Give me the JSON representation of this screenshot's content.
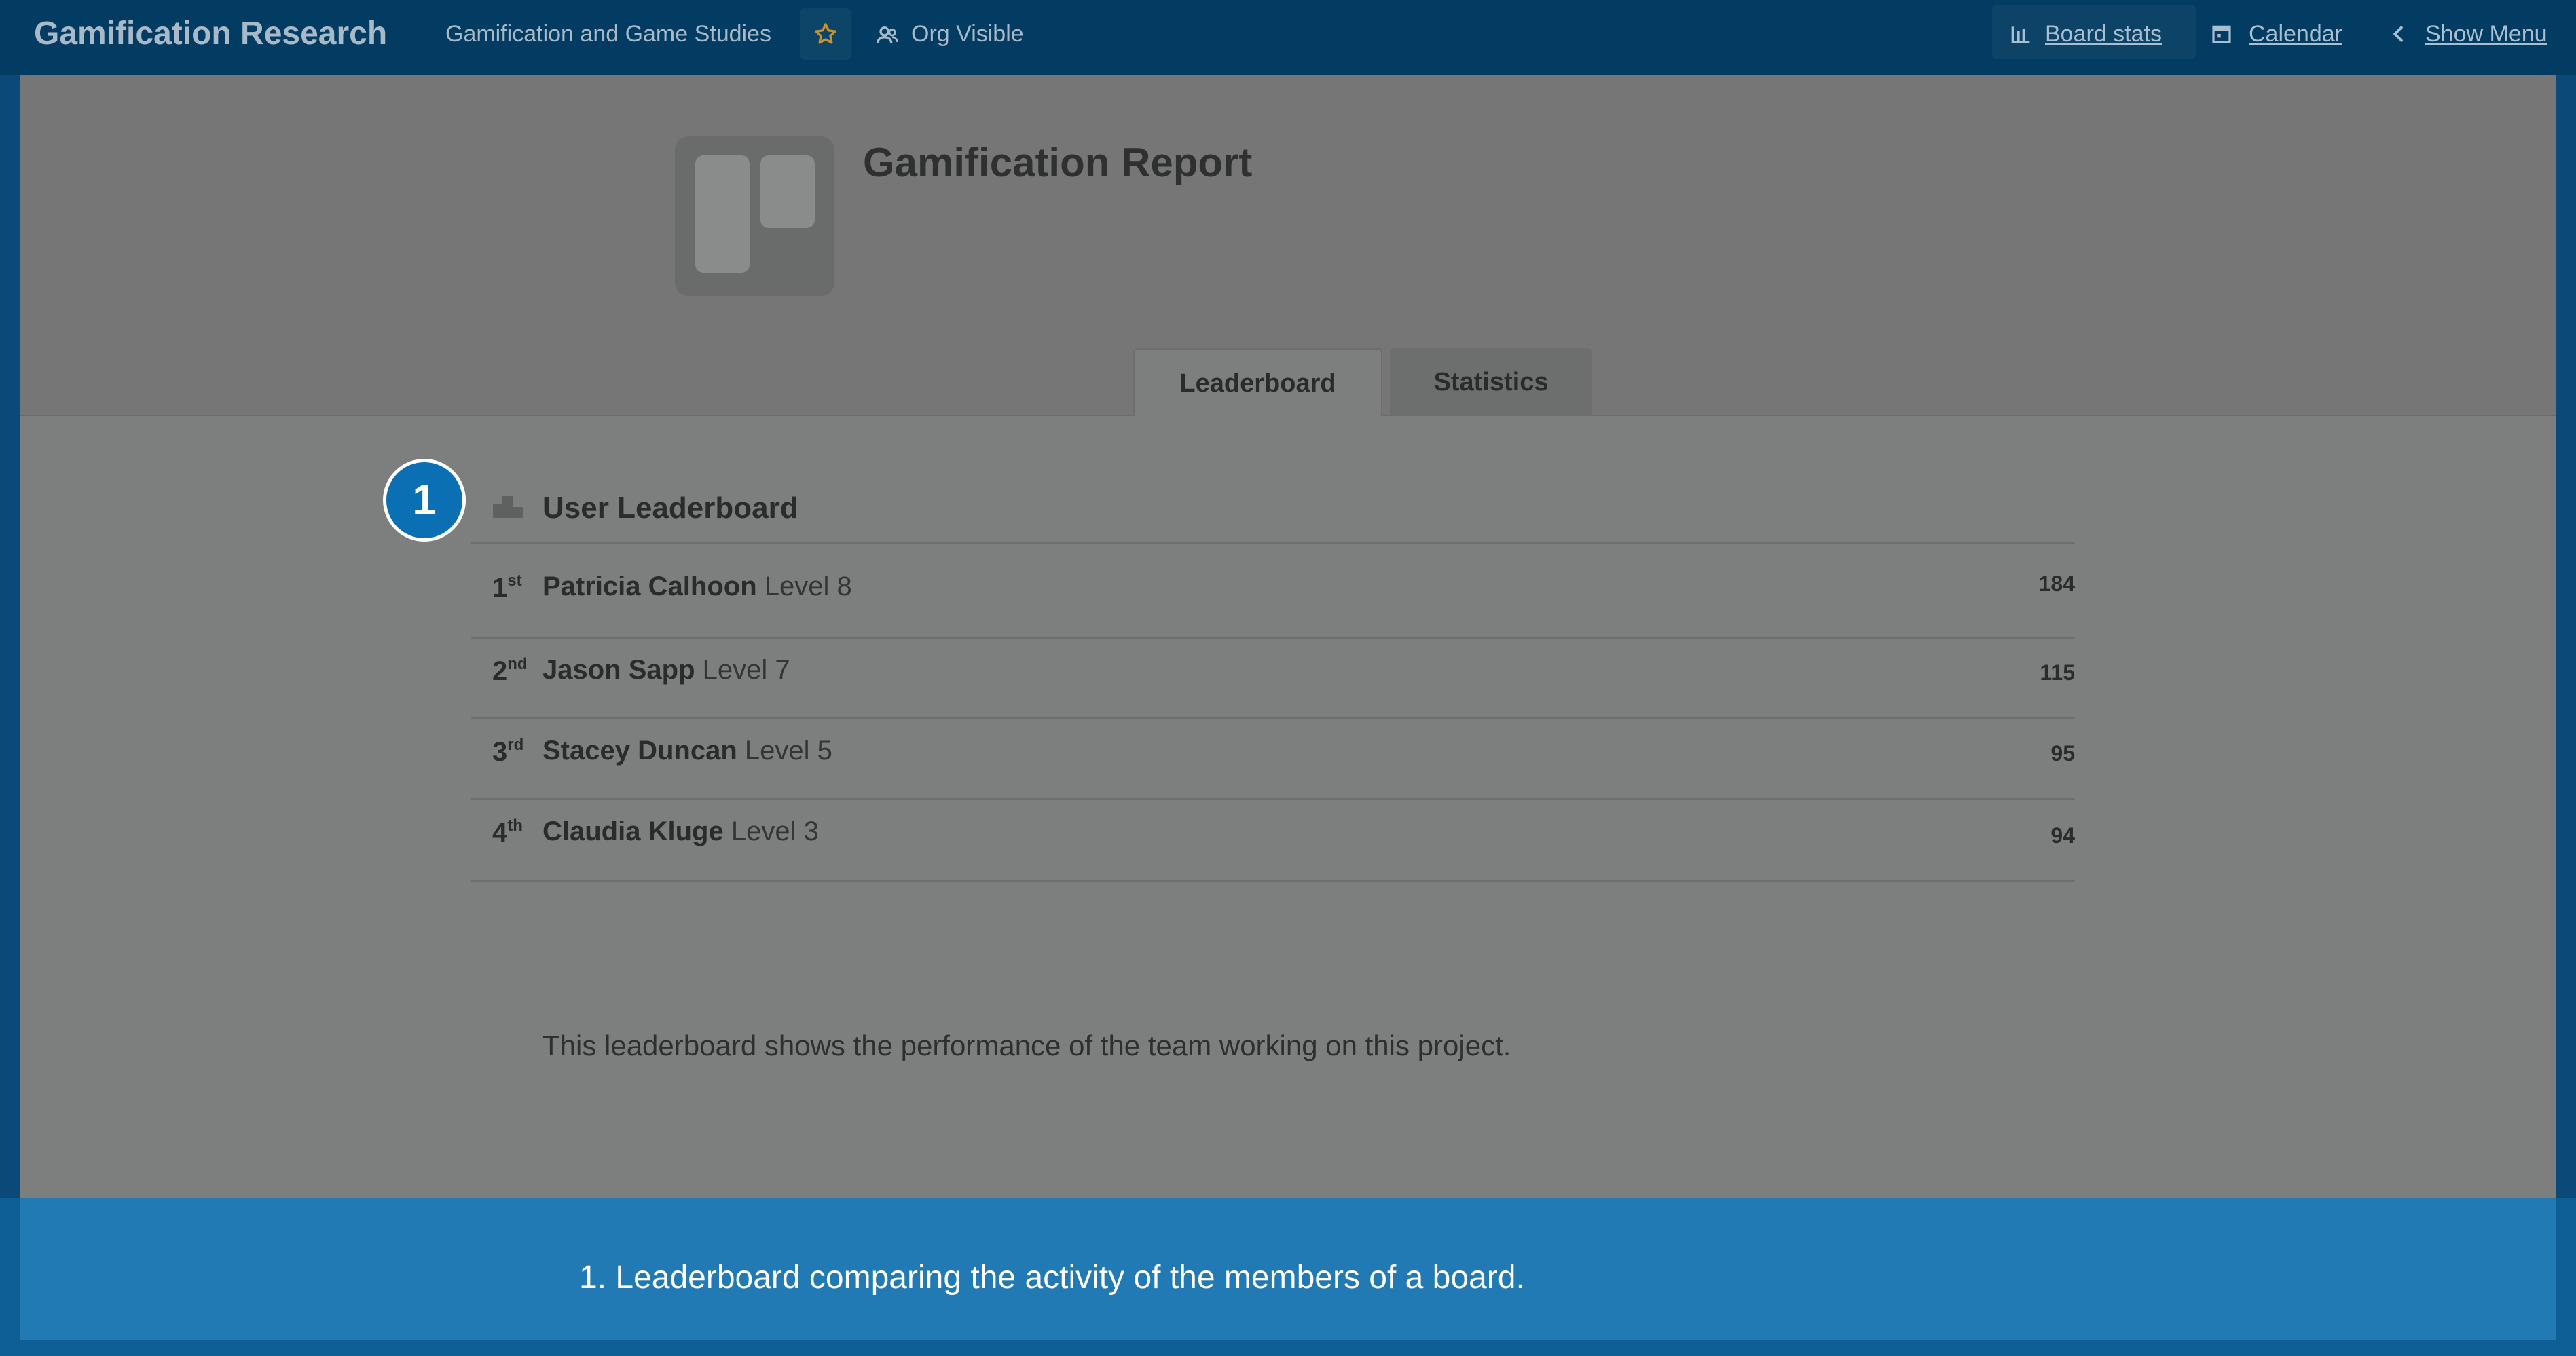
{
  "header": {
    "board_title": "Gamification Research",
    "org_name": "Gamification and Game Studies",
    "visibility": "Org Visible",
    "links": {
      "board_stats": "Board stats",
      "calendar": "Calendar",
      "show_menu": "Show Menu"
    },
    "star_color": "#c9922f"
  },
  "report": {
    "title": "Gamification Report",
    "tabs": [
      {
        "label": "Leaderboard",
        "active": true
      },
      {
        "label": "Statistics",
        "active": false
      }
    ]
  },
  "leaderboard": {
    "title": "User Leaderboard",
    "rows": [
      {
        "rank": "1",
        "suffix": "st",
        "name": "Patricia Calhoon",
        "level": "Level 8",
        "score": "184"
      },
      {
        "rank": "2",
        "suffix": "nd",
        "name": "Jason Sapp",
        "level": "Level 7",
        "score": "115"
      },
      {
        "rank": "3",
        "suffix": "rd",
        "name": "Stacey Duncan",
        "level": "Level 5",
        "score": "95"
      },
      {
        "rank": "4",
        "suffix": "th",
        "name": "Claudia Kluge",
        "level": "Level 3",
        "score": "94"
      }
    ],
    "description": "This leaderboard shows the performance of the team working on this project."
  },
  "callout": {
    "number": "1",
    "caption": "1. Leaderboard comparing the activity of the members of a board.",
    "color": "#0a6fb3"
  }
}
